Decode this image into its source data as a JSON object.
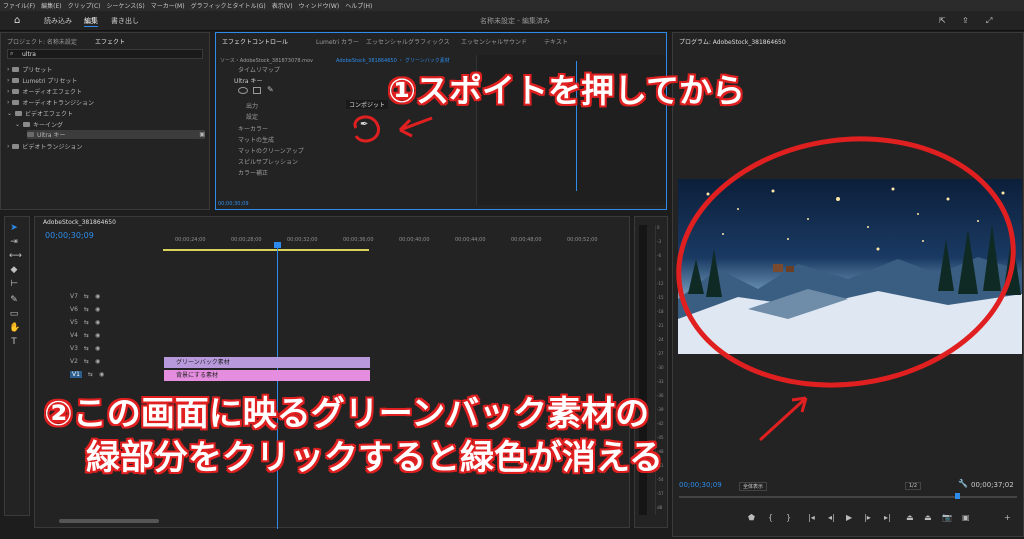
{
  "menu": [
    "ファイル(F)",
    "編集(E)",
    "クリップ(C)",
    "シーケンス(S)",
    "マーカー(M)",
    "グラフィックとタイトル(G)",
    "表示(V)",
    "ウィンドウ(W)",
    "ヘルプ(H)"
  ],
  "workspace": {
    "tabs": [
      "読み込み",
      "編集",
      "書き出し"
    ],
    "title": "名称未設定 - 編集済み"
  },
  "left_panel": {
    "tabs": [
      "プロジェクト: 名称未設定",
      "エフェクト"
    ],
    "search_value": "ultra",
    "tree": [
      {
        "label": "プリセット",
        "indent": 0
      },
      {
        "label": "Lumetri プリセット",
        "indent": 0
      },
      {
        "label": "オーディオエフェクト",
        "indent": 0
      },
      {
        "label": "オーディオトランジション",
        "indent": 0
      },
      {
        "label": "ビデオエフェクト",
        "indent": 0
      },
      {
        "label": "キーイング",
        "indent": 1
      },
      {
        "label": "Ultra キー",
        "indent": 2
      },
      {
        "label": "ビデオトランジション",
        "indent": 0
      }
    ]
  },
  "effect_controls": {
    "tabs": [
      "エフェクトコントロール",
      "Lumetri カラー",
      "エッセンシャルグラフィックス",
      "エッセンシャルサウンド",
      "テキスト"
    ],
    "source": "ソース・AdobeStock_381873078.mov",
    "sequence": "AdobeStock_381864650 ・ グリーンバック素材",
    "rows": [
      "タイムリマップ",
      "Ultra キー",
      "出力",
      "設定",
      "キーカラー",
      "マットの生成",
      "マットのクリーンアップ",
      "スピルサプレッション",
      "カラー補正"
    ],
    "output_value": "コンポジット",
    "timecode": "00;00;30;09"
  },
  "program_monitor": {
    "title": "プログラム: AdobeStock_381864650",
    "timecode": "00;00;30;09",
    "fit": "全体表示",
    "res": "1/2",
    "duration": "00;00;37;02"
  },
  "timeline": {
    "title": "AdobeStock_381864650",
    "timecode": "00;00;30;09",
    "ruler": [
      "00;00;24;00",
      "00;00;28;00",
      "00;00;32;00",
      "00;00;36;00",
      "00;00;40;00",
      "00;00;44;00",
      "00;00;48;00",
      "00;00;52;00"
    ],
    "tracks": [
      "V7",
      "V6",
      "V5",
      "V4",
      "V3",
      "V2",
      "V1"
    ],
    "clips": [
      "グリーンバック素材",
      "背景にする素材"
    ]
  },
  "meter": [
    "0",
    "-3",
    "-6",
    "-9",
    "-12",
    "-15",
    "-18",
    "-21",
    "-24",
    "-27",
    "-30",
    "-33",
    "-36",
    "-39",
    "-42",
    "-45",
    "-48",
    "-51",
    "-54",
    "-57",
    "dB"
  ],
  "annotations": {
    "step1": "①スポイトを押してから",
    "step2_line1": "②この画面に映るグリーンバック素材の",
    "step2_line2": "緑部分をクリックすると緑色が消える"
  },
  "colors": {
    "accent": "#2d8ceb",
    "annotation_red": "#e02020",
    "clip_green": "#b89adc",
    "clip_bg": "#e58ee0"
  }
}
